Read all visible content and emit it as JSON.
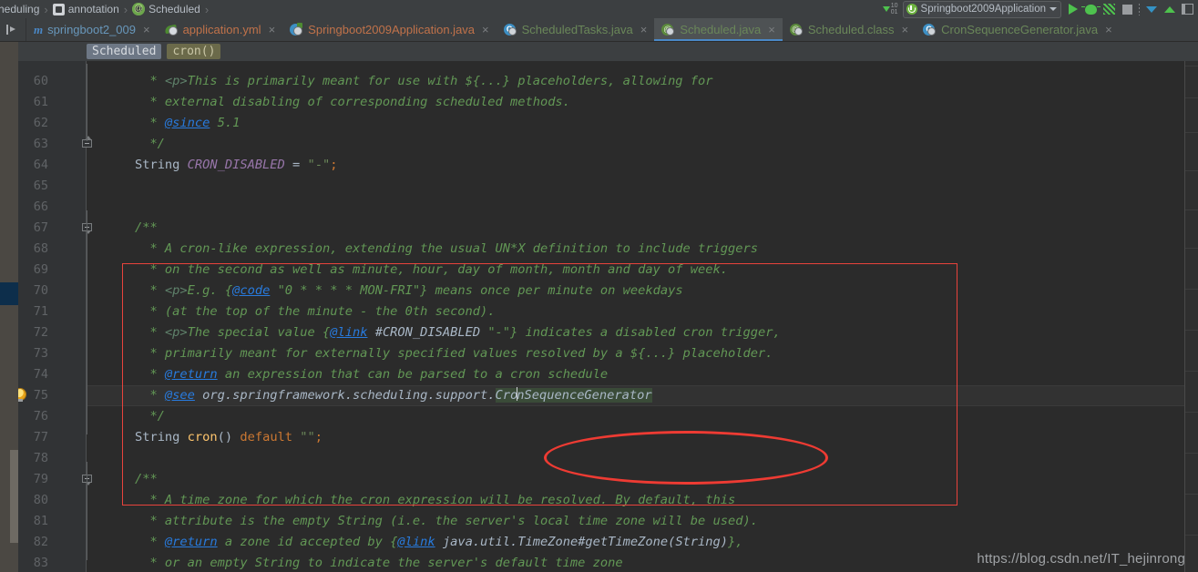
{
  "app": {
    "theme_bg": "#2b2b2b",
    "chrome_bg": "#3c3f41",
    "accent": "#4a88c7",
    "annotation_color": "#ee3b33"
  },
  "breadcrumb_path": {
    "items": [
      {
        "label": "heduling",
        "icon": "package-icon"
      },
      {
        "label": "annotation",
        "icon": "package-icon"
      },
      {
        "label": "Scheduled",
        "icon": "annotation-class-icon"
      }
    ],
    "separator": "›"
  },
  "toolbar": {
    "compile_label": "10\n01",
    "run_configuration": {
      "name": "Springboot2009Application",
      "icon": "spring-boot-icon",
      "caret": "chevron-down-icon"
    },
    "buttons": [
      {
        "name": "run-button",
        "icon": "play-icon",
        "label": "Run"
      },
      {
        "name": "debug-button",
        "icon": "bug-icon",
        "label": "Debug"
      },
      {
        "name": "coverage-button",
        "icon": "coverage-icon",
        "label": "Run with Coverage"
      },
      {
        "name": "stop-button",
        "icon": "stop-icon",
        "label": "Stop"
      },
      {
        "name": "update-project-button",
        "icon": "arrow-down-icon",
        "label": "Update Project"
      },
      {
        "name": "commit-button",
        "icon": "arrow-up-icon",
        "label": "Commit"
      },
      {
        "name": "panel-button",
        "icon": "layout-panel-icon",
        "label": "Layout"
      }
    ]
  },
  "editor_tabs": {
    "toggle_label": "Hide tabs",
    "items": [
      {
        "label": "springboot2_009",
        "icon": "module-icon",
        "active": false,
        "closeable": true,
        "kind": "module"
      },
      {
        "label": "application.yml",
        "icon": "yaml-spring-icon",
        "active": false,
        "closeable": true,
        "kind": "file"
      },
      {
        "label": "Springboot2009Application.java",
        "icon": "spring-class-icon",
        "active": false,
        "closeable": true,
        "kind": "file"
      },
      {
        "label": "ScheduledTasks.java",
        "icon": "java-class-icon",
        "active": false,
        "closeable": true,
        "kind": "green"
      },
      {
        "label": "Scheduled.java",
        "icon": "annotation-class-icon",
        "active": true,
        "closeable": true,
        "kind": "green"
      },
      {
        "label": "Scheduled.class",
        "icon": "annotation-class-icon",
        "active": false,
        "closeable": true,
        "kind": "green"
      },
      {
        "label": "CronSequenceGenerator.java",
        "icon": "java-class-icon",
        "active": false,
        "closeable": true,
        "kind": "green"
      }
    ],
    "close_glyph": "×"
  },
  "structure_breadcrumbs": [
    {
      "label": "Scheduled",
      "kind": "class"
    },
    {
      "label": "cron()",
      "kind": "method"
    }
  ],
  "code": {
    "first_line_number": 60,
    "last_line_number": 83,
    "current_line": 75,
    "selection_text": "CronSequenceGenerator",
    "lines": [
      {
        "n": 60,
        "segments": [
          {
            "t": " * ",
            "c": "cmt"
          },
          {
            "t": "<p>",
            "c": "tag"
          },
          {
            "t": "This is primarily meant for use with ${...} placeholders, allowing for",
            "c": "cmt"
          }
        ]
      },
      {
        "n": 61,
        "segments": [
          {
            "t": " * external disabling of corresponding scheduled methods.",
            "c": "cmt"
          }
        ]
      },
      {
        "n": 62,
        "segments": [
          {
            "t": " * ",
            "c": "cmt"
          },
          {
            "t": "@since",
            "c": "doclink"
          },
          {
            "t": " 5.1",
            "c": "cmt"
          }
        ]
      },
      {
        "n": 63,
        "segments": [
          {
            "t": " */",
            "c": "cmt"
          }
        ]
      },
      {
        "n": 64,
        "segments": [
          {
            "t": "String ",
            "c": "type",
            "indent": "none"
          },
          {
            "t": "CRON_DISABLED",
            "c": "const"
          },
          {
            "t": " = ",
            "c": "op"
          },
          {
            "t": "\"-\"",
            "c": "str"
          },
          {
            "t": ";",
            "c": "semi"
          }
        ],
        "decl": true
      },
      {
        "n": 65,
        "segments": []
      },
      {
        "n": 66,
        "segments": []
      },
      {
        "n": 67,
        "segments": [
          {
            "t": "/**",
            "c": "cmt",
            "indent": "doc"
          }
        ]
      },
      {
        "n": 68,
        "segments": [
          {
            "t": " * A cron-like expression, extending the usual UN*X definition to include triggers",
            "c": "cmt"
          }
        ]
      },
      {
        "n": 69,
        "segments": [
          {
            "t": " * on the second as well as minute, hour, day of month, month and day of week.",
            "c": "cmt"
          }
        ]
      },
      {
        "n": 70,
        "segments": [
          {
            "t": " * ",
            "c": "cmt"
          },
          {
            "t": "<p>",
            "c": "tag"
          },
          {
            "t": "E.g. {",
            "c": "cmt"
          },
          {
            "t": "@code",
            "c": "doclink"
          },
          {
            "t": " \"0 * * * * MON-FRI\"} means once per minute on weekdays",
            "c": "cmt"
          }
        ]
      },
      {
        "n": 71,
        "segments": [
          {
            "t": " * (at the top of the minute - the 0th second).",
            "c": "cmt"
          }
        ]
      },
      {
        "n": 72,
        "segments": [
          {
            "t": " * ",
            "c": "cmt"
          },
          {
            "t": "<p>",
            "c": "tag"
          },
          {
            "t": "The special value {",
            "c": "cmt"
          },
          {
            "t": "@link",
            "c": "doclink"
          },
          {
            "t": " ",
            "c": "cmt"
          },
          {
            "t": "#CRON_DISABLED",
            "c": "linkref"
          },
          {
            "t": " \"-\"} indicates a disabled cron trigger,",
            "c": "cmt"
          }
        ]
      },
      {
        "n": 73,
        "segments": [
          {
            "t": " * primarily meant for externally specified values resolved by a ${...} placeholder.",
            "c": "cmt"
          }
        ]
      },
      {
        "n": 74,
        "segments": [
          {
            "t": " * ",
            "c": "cmt"
          },
          {
            "t": "@return",
            "c": "doclink"
          },
          {
            "t": " an expression that can be parsed to a cron schedule",
            "c": "cmt"
          }
        ]
      },
      {
        "n": 75,
        "segments": [
          {
            "t": " * ",
            "c": "cmt"
          },
          {
            "t": "@see",
            "c": "doclink"
          },
          {
            "t": " org.springframework.scheduling.support.",
            "c": "linkref"
          },
          {
            "t": "CronSequenceGenerator",
            "c": "linkref-selected"
          }
        ]
      },
      {
        "n": 76,
        "segments": [
          {
            "t": " */",
            "c": "cmt"
          }
        ]
      },
      {
        "n": 77,
        "segments": [
          {
            "t": "String ",
            "c": "type",
            "indent": "none"
          },
          {
            "t": "cron",
            "c": "ident"
          },
          {
            "t": "() ",
            "c": "op"
          },
          {
            "t": "default ",
            "c": "kw"
          },
          {
            "t": "\"\"",
            "c": "str"
          },
          {
            "t": ";",
            "c": "semi"
          }
        ],
        "decl": true
      },
      {
        "n": 78,
        "segments": []
      },
      {
        "n": 79,
        "segments": [
          {
            "t": "/**",
            "c": "cmt",
            "indent": "doc"
          }
        ]
      },
      {
        "n": 80,
        "segments": [
          {
            "t": " * A time zone for which the cron expression will be resolved. By default, this",
            "c": "cmt"
          }
        ]
      },
      {
        "n": 81,
        "segments": [
          {
            "t": " * attribute is the empty String (i.e. the server's local time zone will be used).",
            "c": "cmt"
          }
        ]
      },
      {
        "n": 82,
        "segments": [
          {
            "t": " * ",
            "c": "cmt"
          },
          {
            "t": "@return",
            "c": "doclink"
          },
          {
            "t": " a zone id accepted by {",
            "c": "cmt"
          },
          {
            "t": "@link",
            "c": "doclink"
          },
          {
            "t": " ",
            "c": "cmt"
          },
          {
            "t": "java.util.TimeZone#getTimeZone(String)",
            "c": "linkref"
          },
          {
            "t": "},",
            "c": "cmt"
          }
        ]
      },
      {
        "n": 83,
        "segments": [
          {
            "t": " * or an empty String to indicate the server's default time zone",
            "c": "cmt"
          }
        ]
      }
    ]
  },
  "gutter": {
    "fold_markers": [
      {
        "line": 63,
        "type": "up"
      },
      {
        "line": 67,
        "type": "down"
      },
      {
        "line": 79,
        "type": "down"
      }
    ],
    "intention_bulb_line": 75
  },
  "annotations": {
    "rectangle_label": "cron-attribute-highlight",
    "ellipse_label": "cron-sequence-generator-highlight"
  },
  "watermark": {
    "text": "https://blog.csdn.net/IT_hejinrong"
  }
}
